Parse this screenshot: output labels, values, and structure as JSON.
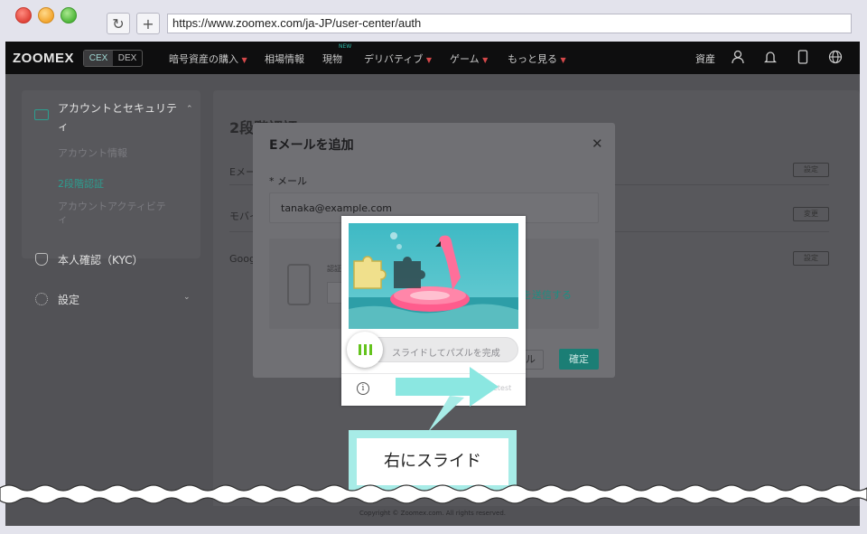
{
  "browser": {
    "url": "https://www.zoomex.com/ja-JP/user-center/auth",
    "reload_icon": "reload-icon",
    "new_tab_icon": "plus-icon"
  },
  "topnav": {
    "logo": "ZOOMEX",
    "cex": "CEX",
    "dex": "DEX",
    "menu": [
      "暗号資産の購入",
      "相場情報",
      "現物",
      "デリバティブ",
      "ゲーム",
      "もっと見る"
    ],
    "new_badge": "NEW",
    "assets": "資産"
  },
  "sidebar": {
    "account_security": "アカウントとセキュリティ",
    "sub_items": [
      "アカウント情報",
      "2段階認証",
      "アカウントアクティビティ"
    ],
    "kyc": "本人確認（KYC）",
    "settings": "設定"
  },
  "main": {
    "title": "2段階認証",
    "rows": [
      "Eメー",
      "モバイ",
      "Googl"
    ],
    "buttons": [
      "設定",
      "変更",
      "設定"
    ]
  },
  "modal": {
    "title": "Eメールを追加",
    "email_label": "* メール",
    "email_value": "tanaka@example.com",
    "code_label": "認証",
    "send_link": "を送信する",
    "cancel": "セル",
    "confirm": "確定"
  },
  "captcha": {
    "slider_text": "スライドしてパズルを完成",
    "brand": "geetest"
  },
  "annotation": {
    "label": "右にスライド",
    "accent": "#a7ece7"
  },
  "footer": {
    "copyright": "Copyright © Zoomex.com. All rights reserved."
  }
}
